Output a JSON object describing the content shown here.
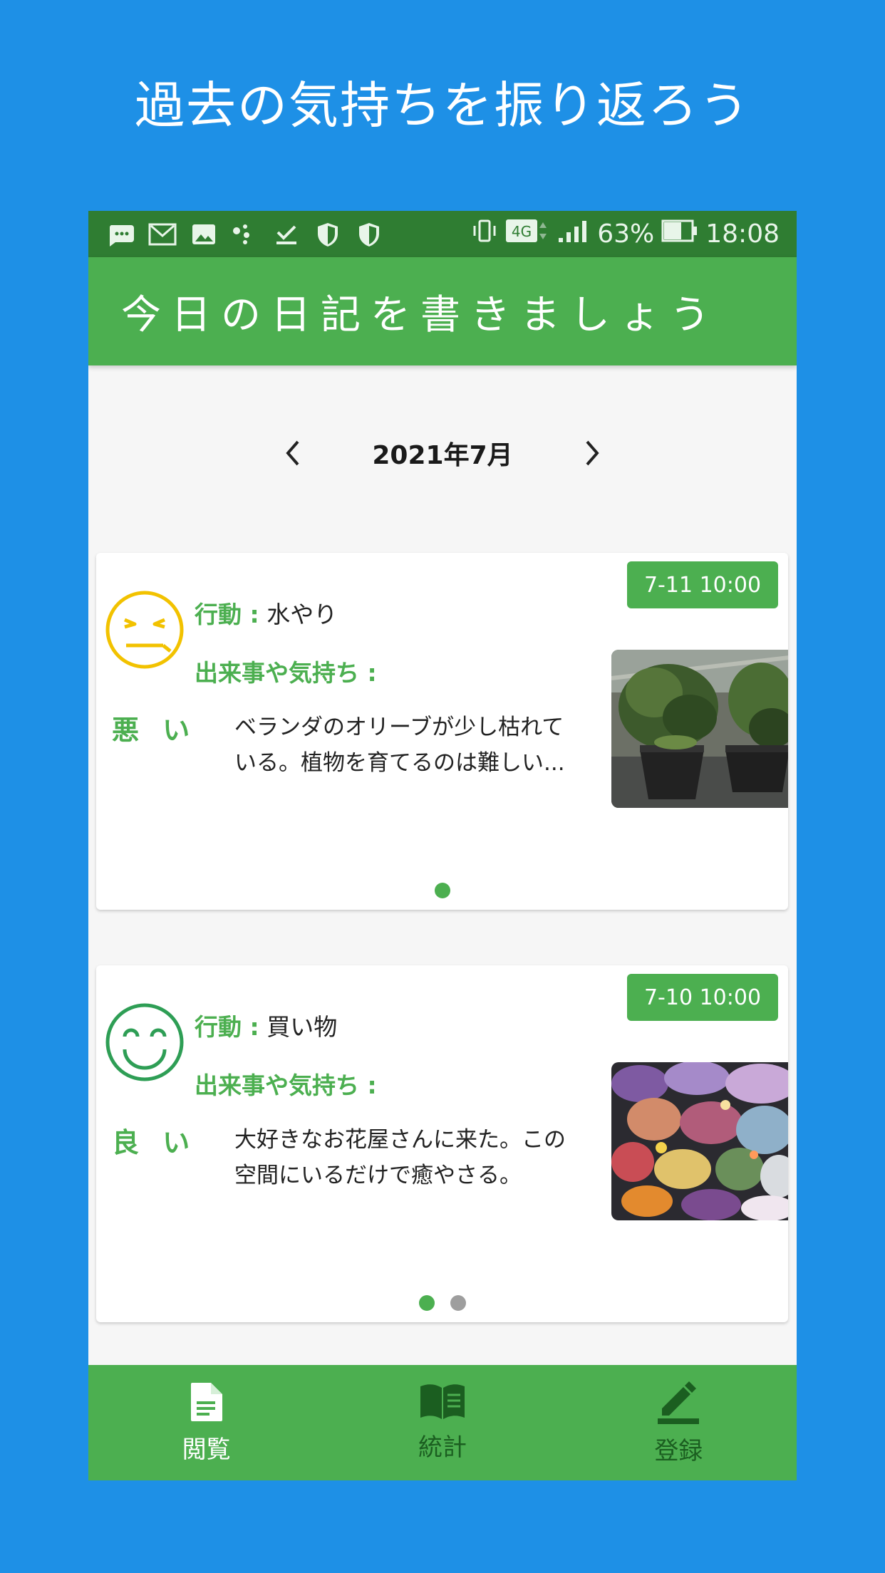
{
  "headline": "過去の気持ちを振り返ろう",
  "status_bar": {
    "battery": "63%",
    "time": "18:08",
    "network": "4G",
    "icons": [
      "messages-icon",
      "gmail-icon",
      "gallery-icon",
      "dots-icon",
      "download-done-icon",
      "shield-icon",
      "shield-icon",
      "vibrate-icon",
      "network-4g-icon",
      "signal-icon",
      "battery-icon"
    ]
  },
  "app_bar": {
    "title": "今日の日記を書きましょう"
  },
  "month_nav": {
    "label": "2021年7月",
    "prev_icon": "chevron-left-icon",
    "next_icon": "chevron-right-icon"
  },
  "entries": [
    {
      "date": "7-11 10:00",
      "mood": "悪 い",
      "mood_icon": "sad-face-icon",
      "mood_color": "#f2c200",
      "action_label": "行動 :",
      "action": "水やり",
      "feeling_label": "出来事や気持ち :",
      "text_line1": "ベランダのオリーブが少し枯れて",
      "text_line2": "いる。植物を育てるのは難しい...",
      "photo": "potted-olive-plants-photo",
      "dots": 1,
      "active_dot": 0
    },
    {
      "date": "7-10 10:00",
      "mood": "良 い",
      "mood_icon": "happy-face-icon",
      "mood_color": "#2e9e55",
      "action_label": "行動 :",
      "action": "買い物",
      "feeling_label": "出来事や気持ち :",
      "text_line1": "大好きなお花屋さんに来た。この",
      "text_line2": "空間にいるだけで癒やさる。",
      "photo": "flower-shop-photo",
      "dots": 2,
      "active_dot": 0
    }
  ],
  "bottom_nav": {
    "items": [
      {
        "label": "閲覧",
        "icon": "document-icon",
        "active": true
      },
      {
        "label": "統計",
        "icon": "book-icon",
        "active": false
      },
      {
        "label": "登録",
        "icon": "edit-icon",
        "active": false
      }
    ]
  },
  "colors": {
    "brand": "#4caf50",
    "statusbar": "#2f7d32",
    "background": "#1e90e6"
  }
}
